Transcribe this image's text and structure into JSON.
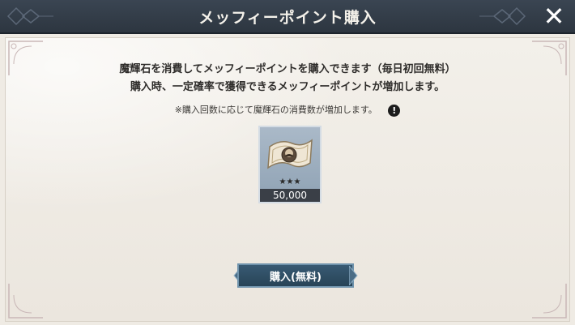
{
  "header": {
    "title": "メッフィーポイント購入",
    "close_label": "✕"
  },
  "description": {
    "line1": "魔輝石を消費してメッフィーポイントを購入できます（毎日初回無料）",
    "line2": "購入時、一定確率で獲得できるメッフィーポイントが増加します。"
  },
  "note": {
    "text": "※購入回数に応じて魔輝石の消費数が増加します。",
    "icon": "exclamation-icon",
    "icon_glyph": "!"
  },
  "item": {
    "icon": "banknote-icon",
    "rarity": "★★★",
    "quantity": "50,000"
  },
  "purchase_button": {
    "label": "購入(無料)"
  },
  "colors": {
    "header_bg": "#2d3640",
    "panel_bg": "#efebe4",
    "button_bg": "#2f4e64",
    "card_bg": "#9cadbe"
  }
}
